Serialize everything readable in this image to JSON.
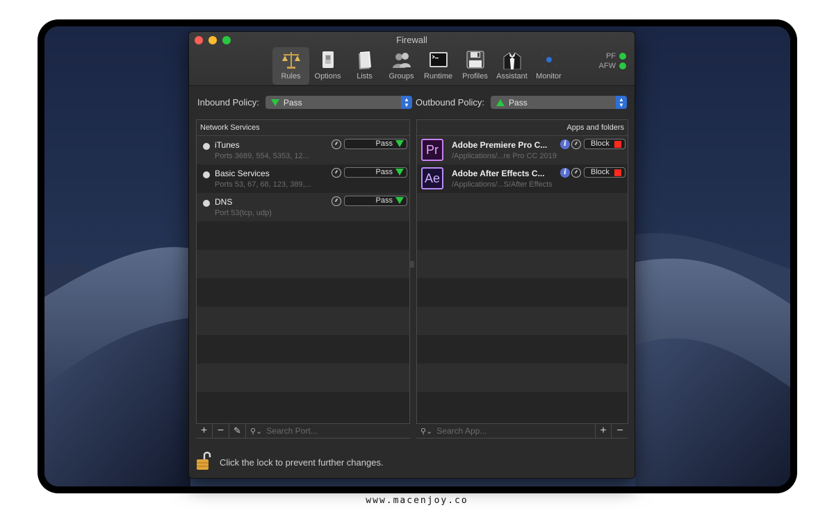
{
  "window": {
    "title": "Firewall"
  },
  "toolbar": {
    "items": [
      {
        "label": "Rules",
        "icon": "scales-icon",
        "active": true
      },
      {
        "label": "Options",
        "icon": "switch-icon",
        "active": false
      },
      {
        "label": "Lists",
        "icon": "document-icon",
        "active": false
      },
      {
        "label": "Groups",
        "icon": "people-icon",
        "active": false
      },
      {
        "label": "Runtime",
        "icon": "terminal-icon",
        "active": false
      },
      {
        "label": "Profiles",
        "icon": "floppy-disk-icon",
        "active": false
      },
      {
        "label": "Assistant",
        "icon": "butler-icon",
        "active": false
      },
      {
        "label": "Monitor",
        "icon": "radar-icon",
        "active": false
      }
    ]
  },
  "status": {
    "pf_label": "PF",
    "afw_label": "AFW",
    "indicator_color": "#28c840"
  },
  "inbound": {
    "label": "Inbound Policy:",
    "value": "Pass"
  },
  "outbound": {
    "label": "Outbound Policy:",
    "value": "Pass"
  },
  "services": {
    "header": "Network Services",
    "items": [
      {
        "name": "iTunes",
        "ports": "Ports 3689, 554, 5353, 12...",
        "action": "Pass"
      },
      {
        "name": "Basic Services",
        "ports": "Ports 53, 67, 68, 123, 389,...",
        "action": "Pass"
      },
      {
        "name": "DNS",
        "ports": "Port 53(tcp, udp)",
        "action": "Pass"
      }
    ],
    "search_placeholder": "Search Port...",
    "add_label": "+",
    "remove_label": "−"
  },
  "apps": {
    "header": "Apps and folders",
    "items": [
      {
        "abbr": "Pr",
        "name": "Adobe Premiere Pro C...",
        "path": "/Applications/...re Pro CC 2019",
        "action": "Block"
      },
      {
        "abbr": "Ae",
        "name": "Adobe After Effects C...",
        "path": "/Applications/...S/After Effects",
        "action": "Block"
      }
    ],
    "search_placeholder": "Search App...",
    "add_label": "+",
    "remove_label": "−"
  },
  "lock": {
    "text": "Click the lock to prevent further changes."
  },
  "footer": {
    "watermark": "www.macenjoy.co"
  },
  "colors": {
    "pass": "#28c840",
    "block": "#ff2a1e",
    "accent": "#2f6fd6"
  }
}
